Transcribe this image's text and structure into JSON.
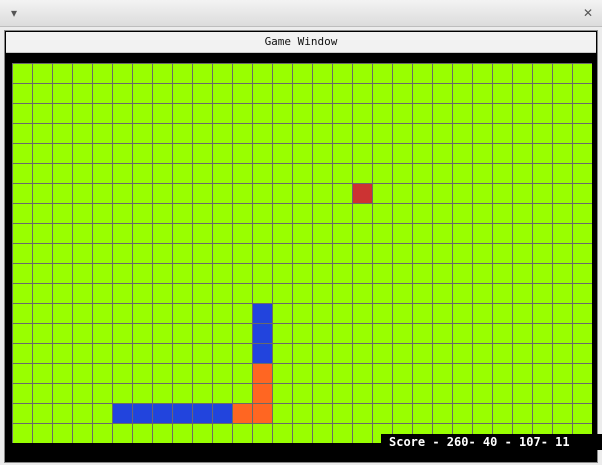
{
  "window": {
    "title": "Game Window",
    "menu_glyph": "▾",
    "close_glyph": "✕"
  },
  "board": {
    "cols": 29,
    "rows": 19,
    "background": "#99ff00",
    "grid_color": "#6a6a6a"
  },
  "food": {
    "col": 17,
    "row": 6,
    "color": "#cc3333"
  },
  "snake_blue": {
    "color": "#2244dd",
    "cells": [
      [
        12,
        12
      ],
      [
        12,
        13
      ],
      [
        12,
        14
      ],
      [
        5,
        17
      ],
      [
        6,
        17
      ],
      [
        7,
        17
      ],
      [
        8,
        17
      ],
      [
        9,
        17
      ],
      [
        10,
        17
      ]
    ]
  },
  "snake_orange": {
    "color": "#ff6622",
    "cells": [
      [
        12,
        15
      ],
      [
        12,
        16
      ],
      [
        12,
        17
      ],
      [
        11,
        17
      ]
    ]
  },
  "status": {
    "score_text": "Score - 260- 40 - 107- 11"
  }
}
